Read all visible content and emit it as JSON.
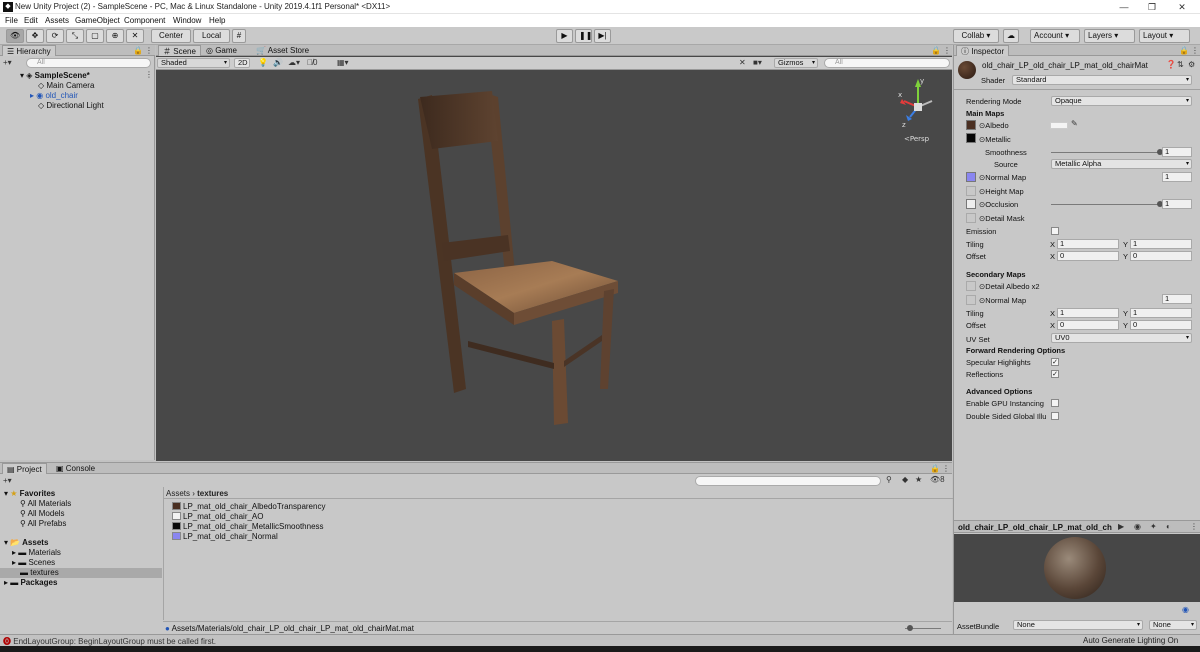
{
  "window": {
    "title": "New Unity Project (2) - SampleScene - PC, Mac & Linux Standalone - Unity 2019.4.1f1 Personal* <DX11>",
    "controls": [
      "—",
      "❐",
      "✕"
    ]
  },
  "menu": [
    "File",
    "Edit",
    "Assets",
    "GameObject",
    "Component",
    "Window",
    "Help"
  ],
  "toolbar": {
    "center_label": "Center",
    "local_label": "Local",
    "collab_label": "Collab ▾",
    "account_label": "Account",
    "layers_label": "Layers",
    "layout_label": "Layout"
  },
  "hierarchy": {
    "tab_label": "Hierarchy",
    "search_placeholder": "All",
    "scene_name": "SampleScene*",
    "items": [
      "Main Camera",
      "old_chair",
      "Directional Light"
    ]
  },
  "scene": {
    "tabs": [
      "Scene",
      "Game",
      "Asset Store"
    ],
    "shading_mode": "Shaded",
    "mode_2d": "2D",
    "hidden_count": "0",
    "gizmos_label": "Gizmos",
    "search_placeholder": "All",
    "persp_label": "<Persp",
    "gizmo_axes": {
      "y": "y",
      "z": "z",
      "x": "x"
    },
    "colors": {
      "background": "#484848",
      "axis_x": "#e33b3b",
      "axis_y": "#7fd13b",
      "axis_z": "#3b7ee3"
    }
  },
  "project": {
    "tabs": [
      "Project",
      "Console"
    ],
    "favorites_label": "Favorites",
    "favorites": [
      "All Materials",
      "All Models",
      "All Prefabs"
    ],
    "assets_label": "Assets",
    "asset_folders": [
      "Materials",
      "Scenes",
      "textures"
    ],
    "packages_label": "Packages",
    "breadcrumb": [
      "Assets",
      "textures"
    ],
    "files": [
      {
        "name": "LP_mat_old_chair_AlbedoTransparency",
        "color": "#4a2f22"
      },
      {
        "name": "LP_mat_old_chair_AO",
        "color": "#f2f2f2"
      },
      {
        "name": "LP_mat_old_chair_MetallicSmoothness",
        "color": "#0a0a0a"
      },
      {
        "name": "LP_mat_old_chair_Normal",
        "color": "#8a86f0"
      }
    ],
    "path": "Assets/Materials/old_chair_LP_old_chair_LP_mat_old_chairMat.mat",
    "badge_count": "8"
  },
  "inspector": {
    "tab_label": "Inspector",
    "material_name": "old_chair_LP_old_chair_LP_mat_old_chairMat",
    "shader_label": "Shader",
    "shader_value": "Standard",
    "rendering_mode_label": "Rendering Mode",
    "rendering_mode_value": "Opaque",
    "main_maps_label": "Main Maps",
    "albedo_label": "Albedo",
    "metallic_label": "Metallic",
    "smoothness_label": "Smoothness",
    "smoothness_value": "1",
    "smoothness_fraction": 1.0,
    "source_label": "Source",
    "source_value": "Metallic Alpha",
    "normal_map_label": "Normal Map",
    "normal_map_value": "1",
    "height_map_label": "Height Map",
    "occlusion_label": "Occlusion",
    "occlusion_value": "1",
    "occlusion_fraction": 1.0,
    "detail_mask_label": "Detail Mask",
    "emission_label": "Emission",
    "tiling_label": "Tiling",
    "offset_label": "Offset",
    "tiling": {
      "x": "1",
      "y": "1"
    },
    "offset": {
      "x": "0",
      "y": "0"
    },
    "secondary_maps_label": "Secondary Maps",
    "detail_albedo_label": "Detail Albedo x2",
    "secondary_normal_label": "Normal Map",
    "secondary_normal_value": "1",
    "tiling2": {
      "x": "1",
      "y": "1"
    },
    "offset2": {
      "x": "0",
      "y": "0"
    },
    "uv_set_label": "UV Set",
    "uv_set_value": "UV0",
    "forward_label": "Forward Rendering Options",
    "specular_label": "Specular Highlights",
    "reflections_label": "Reflections",
    "advanced_label": "Advanced Options",
    "gpu_instancing_label": "Enable GPU Instancing",
    "double_sided_label": "Double Sided Global Illu",
    "x_label": "X",
    "y_label": "Y",
    "preview_title": "old_chair_LP_old_chair_LP_mat_old_ch",
    "assetbundle_label": "AssetBundle",
    "assetbundle_value": "None",
    "assetbundle_variant": "None",
    "swatch_colors": {
      "albedo": "#4a2f22",
      "metallic": "#050505",
      "normal": "#8a86f0",
      "occlusion": "#eeeeee"
    }
  },
  "status": {
    "error_text": "EndLayoutGroup: BeginLayoutGroup must be called first.",
    "lighting_text": "Auto Generate Lighting On"
  }
}
